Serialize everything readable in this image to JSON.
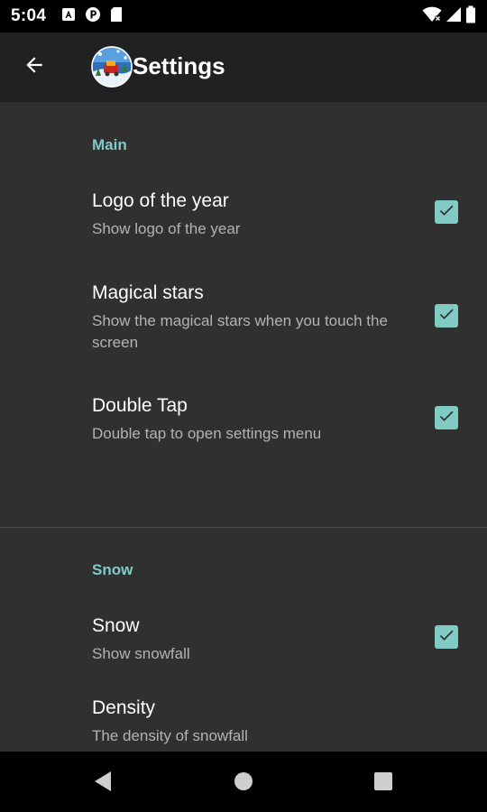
{
  "status_bar": {
    "time": "5:04",
    "left_icons": [
      "a-icon",
      "p-icon",
      "sd-card-icon"
    ],
    "right_icons": [
      "wifi-icon",
      "signal-icon",
      "battery-icon"
    ]
  },
  "app_bar": {
    "title": "Settings",
    "back_icon": "arrow-back-icon",
    "logo_icon": "app-logo-icon"
  },
  "categories": [
    {
      "title": "Main",
      "items": [
        {
          "title": "Logo of the year",
          "summary": "Show logo of the year",
          "checked": true
        },
        {
          "title": "Magical stars",
          "summary": "Show the magical stars when you touch the screen",
          "checked": true
        },
        {
          "title": "Double Tap",
          "summary": "Double tap to open settings menu",
          "checked": true
        }
      ]
    },
    {
      "title": "Snow",
      "items": [
        {
          "title": "Snow",
          "summary": "Show snowfall",
          "checked": true
        },
        {
          "title": "Density",
          "summary": "The density of snowfall"
        }
      ]
    }
  ],
  "nav_bar": {
    "buttons": [
      "back-triangle-icon",
      "home-circle-icon",
      "recents-square-icon"
    ]
  },
  "colors": {
    "accent": "#80cbc4",
    "background": "#303030",
    "app_bar": "#212121"
  }
}
